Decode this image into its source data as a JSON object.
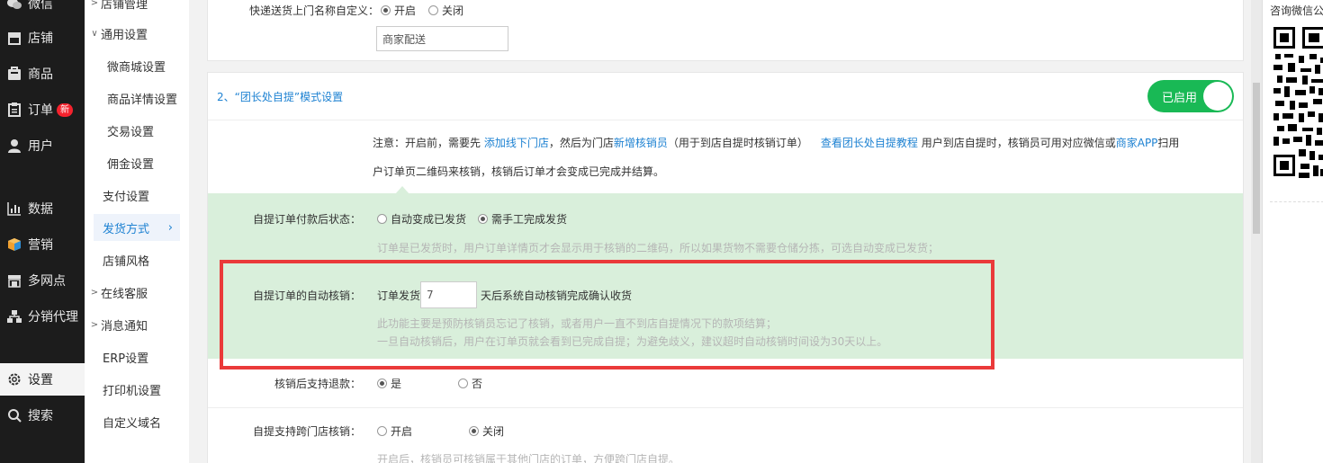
{
  "nav": {
    "items": [
      {
        "label": "微信",
        "icon": "wechat-icon"
      },
      {
        "label": "店铺",
        "icon": "store-icon"
      },
      {
        "label": "商品",
        "icon": "product-icon"
      },
      {
        "label": "订单",
        "icon": "order-icon",
        "badge": "新"
      },
      {
        "label": "用户",
        "icon": "user-icon"
      },
      {
        "label": "数据",
        "icon": "chart-icon"
      },
      {
        "label": "营销",
        "icon": "marketing-icon"
      },
      {
        "label": "多网点",
        "icon": "multi-store-icon"
      },
      {
        "label": "分销代理",
        "icon": "distribution-icon"
      },
      {
        "label": "设置",
        "icon": "gear-icon"
      },
      {
        "label": "搜索",
        "icon": "search-icon"
      }
    ]
  },
  "submenu": {
    "items": [
      {
        "label": "店铺管理"
      },
      {
        "label": "通用设置"
      },
      {
        "label": "微商城设置"
      },
      {
        "label": "商品详情设置"
      },
      {
        "label": "交易设置"
      },
      {
        "label": "佣金设置"
      },
      {
        "label": "支付设置"
      },
      {
        "label": "发货方式"
      },
      {
        "label": "店铺风格"
      },
      {
        "label": "在线客服"
      },
      {
        "label": "消息通知"
      },
      {
        "label": "ERP设置"
      },
      {
        "label": "打印机设置"
      },
      {
        "label": "自定义域名"
      }
    ]
  },
  "card1": {
    "label": "快递送货上门名称自定义：",
    "opt_on": "开启",
    "opt_off": "关闭",
    "input_value": "商家配送"
  },
  "card2": {
    "title": "2、“团长处自提”模式设置",
    "toggle_label": "已启用",
    "notice": {
      "prefix": "注意：开启前，需要先 ",
      "link1": "添加线下门店",
      "mid1": "，然后为门店",
      "link2": "新增核销员",
      "mid2": "（用于到店自提时核销订单）",
      "link3": "查看团长处自提教程",
      "mid3": " 用户到店自提时，核销员可用对应微信或",
      "link4": "商家APP",
      "suffix": "扫用",
      "line2": "户订单页二维码来核销，核销后订单才会变成已完成并结算。"
    },
    "pay_status": {
      "label": "自提订单付款后状态：",
      "opt1": "自动变成已发货",
      "opt2": "需手工完成发货",
      "hint": "订单是已发货时，用户订单详情页才会显示用于核销的二维码，所以如果货物不需要仓储分拣，可选自动变成已发货；"
    },
    "auto_verify": {
      "label": "自提订单的自动核销：",
      "prefix": "订单发货",
      "days": "7",
      "suffix": "天后系统自动核销完成确认收货",
      "hint1": "此功能主要是预防核销员忘记了核销，或者用户一直不到店自提情况下的款项结算；",
      "hint2": "一旦自动核销后，用户在订单页就会看到已完成自提；为避免歧义，建议超时自动核销时间设为30天以上。"
    },
    "refund": {
      "label": "核销后支持退款：",
      "opt_yes": "是",
      "opt_no": "否"
    },
    "cross_store": {
      "label": "自提支持跨门店核销：",
      "opt_on": "开启",
      "opt_off": "关闭",
      "hint": "开启后，核销员可核销属于其他门店的订单，方便跨门店自提。"
    }
  },
  "qr": {
    "title": "咨询微信公"
  },
  "colors": {
    "accent": "#1e82d2",
    "toggle_green": "#19b955",
    "green_bg": "#d9efdb",
    "highlight_red": "#ea3a3a"
  }
}
